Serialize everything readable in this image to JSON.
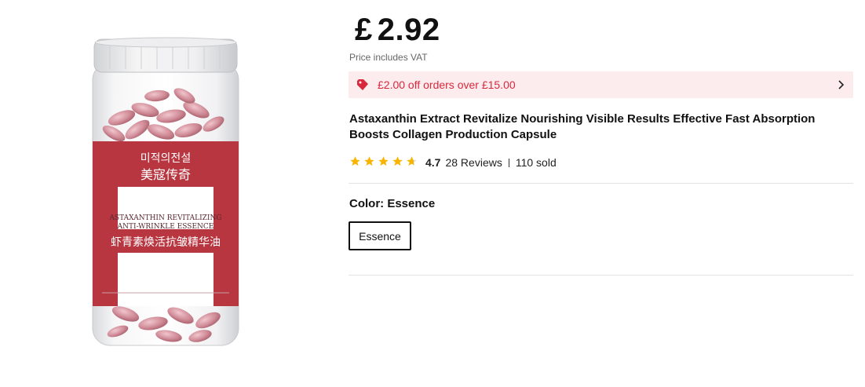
{
  "product": {
    "image_label_korean": "미적의전설",
    "image_label_chinese": "美寇传奇",
    "image_label_english_1": "ASTAXANTHIN REVITALIZING",
    "image_label_english_2": "ANTI-WRINKLE ESSENCE",
    "image_band_chinese": "虾青素焕活抗皱精华油",
    "price_currency": "£",
    "price_value": "2.92",
    "price_note": "Price includes VAT",
    "promo_text": "£2.00 off orders over £15.00",
    "title": "Astaxanthin Extract Revitalize Nourishing Visible Results Effective Fast Absorption Boosts Collagen Production Capsule",
    "rating_value": "4.7",
    "rating_stars": 4.7,
    "reviews": "28 Reviews",
    "sold": "110 sold",
    "color_label": "Color: Essence",
    "color_option": "Essence"
  },
  "colors": {
    "accent": "#d8283d",
    "promo_bg": "#fdecee",
    "star": "#f7b500"
  },
  "icons": {
    "promo": "price-tag-icon",
    "promo_arrow": "chevron-right-icon",
    "star": "star-icon"
  }
}
